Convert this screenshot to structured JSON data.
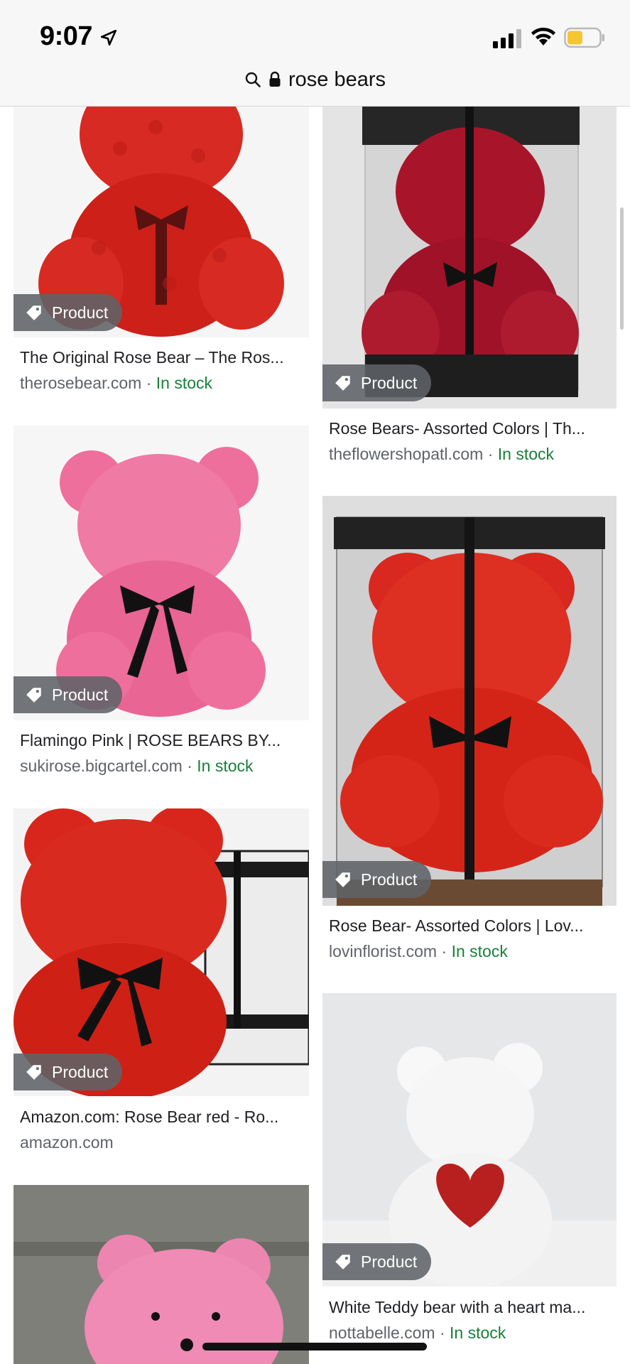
{
  "status": {
    "time": "9:07"
  },
  "address_bar": {
    "query": "rose bears"
  },
  "badge_label": "Product",
  "results": [
    {
      "title": "The Original Rose Bear – The Ros...",
      "source": "therosebear.com",
      "stock": "In stock",
      "separator": " · "
    },
    {
      "title": "Rose Bears- Assorted Colors | Th...",
      "source": "theflowershopatl.com",
      "stock": "In stock",
      "separator": " · "
    },
    {
      "title": "Flamingo Pink | ROSE BEARS BY...",
      "source": "sukirose.bigcartel.com",
      "stock": "In stock",
      "separator": " · "
    },
    {
      "title": "Rose Bear- Assorted Colors | Lov...",
      "source": "lovinflorist.com",
      "stock": "In stock",
      "separator": " · "
    },
    {
      "title": "Amazon.com: Rose Bear red - Ro...",
      "source": "amazon.com",
      "stock": "",
      "separator": ""
    },
    {
      "title": "White Teddy bear with a heart ma...",
      "source": "nottabelle.com",
      "stock": "In stock",
      "separator": " · "
    }
  ],
  "colors": {
    "in_stock": "#188038",
    "rose_red": "#d8281f",
    "rose_pink": "#ee6f9b",
    "badge_bg": "#5f6368"
  }
}
